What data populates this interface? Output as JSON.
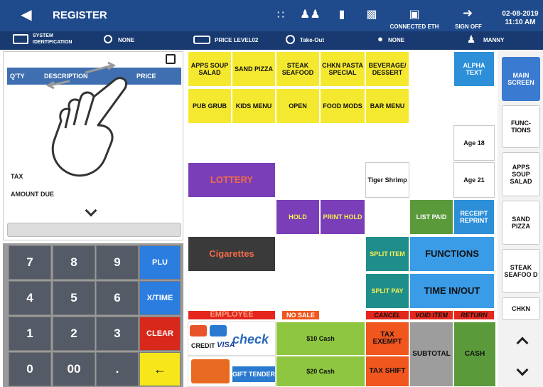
{
  "topbar": {
    "back_icon": "back-arrow-icon",
    "title": "REGISTER",
    "connected_label": "CONNECTED ETH",
    "signoff_label": "SIGN OFF",
    "date": "02-08-2019",
    "time": "11:10 AM"
  },
  "subbar": {
    "system_label_1": "SYSTEM",
    "system_label_2": "IDENTIFICATION",
    "search_value": "NONE",
    "price_level": "PRICE LEVEL02",
    "order_type": "Take-Out",
    "location_value": "NONE",
    "user": "MANNY"
  },
  "order": {
    "col_qty": "Q'TY",
    "col_desc": "DESCRIPTION",
    "col_price": "PRICE",
    "tax_label": "TAX",
    "amount_due_label": "AMOUNT DUE"
  },
  "keypad": {
    "k7": "7",
    "k8": "8",
    "k9": "9",
    "plu": "PLU",
    "k4": "4",
    "k5": "5",
    "k6": "6",
    "xtime": "X/TIME",
    "k1": "1",
    "k2": "2",
    "k3": "3",
    "clear": "CLEAR",
    "k0": "0",
    "k00": "00",
    "dot": ".",
    "back": "←"
  },
  "grid": {
    "apps_soup_salad": "APPS SOUP SALAD",
    "sand_pizza": "SAND PIZZA",
    "steak_seafood": "STEAK SEAFOOD",
    "chkn_pasta_special": "CHKN PASTA SPECIAL",
    "beverage_dessert": "BEVERAGE/ DESSERT",
    "alpha_text": "ALPHA TEXT",
    "pub_grub": "PUB GRUB",
    "kids_menu": "KIDS MENU",
    "open": "OPEN",
    "food_mods": "FOOD MODS",
    "bar_menu": "BAR MENU",
    "age18": "Age 18",
    "lottery": "LOTTERY",
    "tiger_shrimp": "Tiger Shrimp",
    "age21": "Age 21",
    "hold": "HOLD",
    "print_hold": "PRINT HOLD",
    "list_paid": "LIST PAID",
    "receipt_reprint": "RECEIPT REPRINT",
    "cigarettes": "Cigarettes",
    "split_item": "SPLIT ITEM",
    "functions": "FUNCTIONS",
    "split_pay": "SPLIT PAY",
    "time_in_out": "TIME IN/OUT",
    "employee": "EMPLOYEE",
    "no_sale": "NO SALE",
    "cancel": "CANCEL",
    "void_item": "VOID ITEM",
    "return": "RETURN",
    "credit": "CREDIT",
    "visa": "VISA",
    "check": "check",
    "gift_tender": "GIFT TENDER",
    "cash10": "$10 Cash",
    "cash20": "$20 Cash",
    "tax_exempt": "TAX EXEMPT",
    "tax_shift": "TAX SHIFT",
    "subtotal": "SUBTOTAL",
    "cash": "CASH"
  },
  "right": {
    "main_screen": "MAIN SCREEN",
    "functions": "FUNC- TIONS",
    "apps_soup_salad": "APPS SOUP SALAD",
    "sand_pizza": "SAND PIZZA",
    "steak_seafood": "STEAK SEAFOO D",
    "chkn": "CHKN"
  }
}
